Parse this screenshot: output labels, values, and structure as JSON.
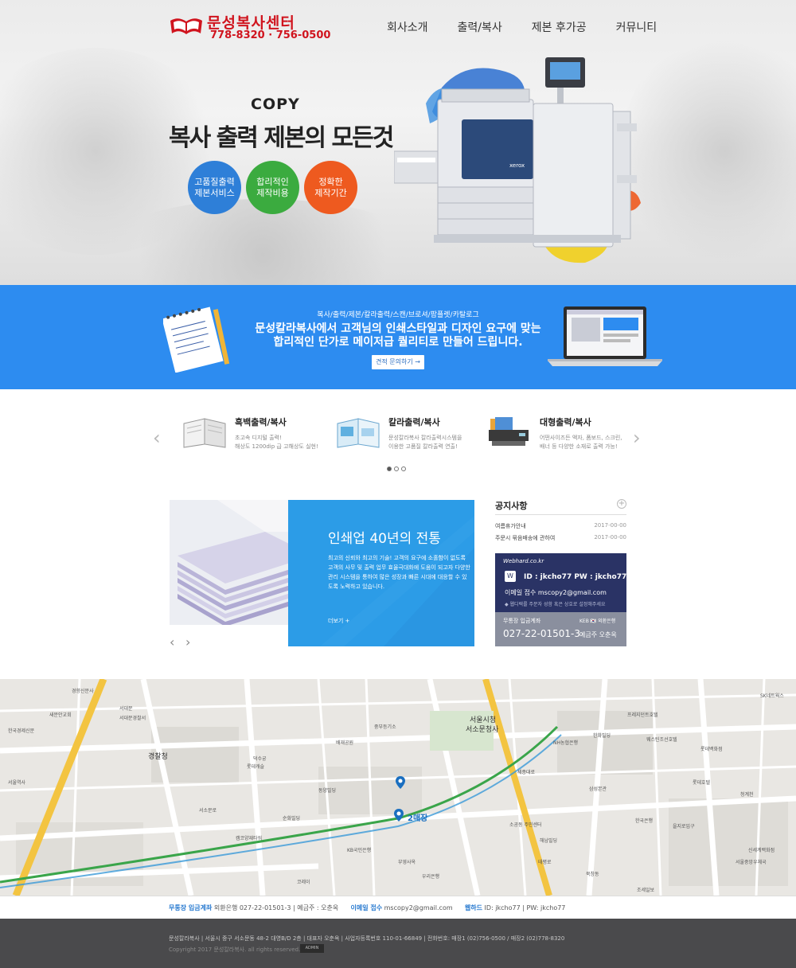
{
  "header": {
    "logo_name": "문성복사센터",
    "logo_phone": "778-8320 · 756-0500",
    "nav": [
      "회사소개",
      "출력/복사",
      "제본 후가공",
      "커뮤니티"
    ]
  },
  "hero": {
    "eyebrow": "COPY",
    "title": "복사 출력 제본의 모든것",
    "badges": [
      {
        "line1": "고품질출력",
        "line2": "제본서비스",
        "color": "#2e7fd8"
      },
      {
        "line1": "합리적인",
        "line2": "제작비용",
        "color": "#3bab3f"
      },
      {
        "line1": "정확한",
        "line2": "제작기간",
        "color": "#ee5a1f"
      }
    ],
    "printer_brand": "xerox"
  },
  "banner": {
    "sub": "복사/출력/제본/칼라출력/스캔/브로셔/팜플렛/카탈로그",
    "line1": "문성칼라복사에서 고객님의 인쇄스타일과 디자인 요구에 맞는",
    "line2": "합리적인 단가로 메이저급 퀄리티로 만들어 드립니다.",
    "button": "견적 문의하기 →"
  },
  "services": [
    {
      "title": "흑백출력/복사",
      "d1": "초고속 디지털 출력!",
      "d2": "해상도 1200dip 급 고해상도 실현!"
    },
    {
      "title": "칼라출력/복사",
      "d1": "문성칼라복사 칼라출력시스템을",
      "d2": "이용한 고품질 칼라출력 연출!"
    },
    {
      "title": "대형출력/복사",
      "d1": "어떤사이즈든 액자, 폼보드, 스크린,",
      "d2": "배너 등 다양한 소재로 출력 가능!"
    }
  ],
  "feature": {
    "title": "인쇄업 40년의 전통",
    "body": "최고의 신뢰와 최고의 기술! 고객의 요구에 소홀함이 없도록 고객의 사무 및 출력 업무 효율극대화에 도움이 되고자 다양한 관리 시스템을 통하여 많은 성장과 빠른 시대에 대응할 수 있도록 노력하고 있습니다.",
    "more": "더보기 +"
  },
  "notice": {
    "title": "공지사항",
    "items": [
      {
        "title": "여름휴가안내",
        "date": "2017-00-00"
      },
      {
        "title": "주문시 묶음배송에 관하여",
        "date": "2017-00-00"
      }
    ]
  },
  "webhard": {
    "brand": "Webhard.co.kr",
    "icon": "W",
    "idpw": "ID : jkcho77    PW : jkcho77",
    "mail": "이메일 접수     mscopy2@gmail.com",
    "note": "◆ 웹디렉를 주문자 성함 혹은 상호로 설정해주세요",
    "bank_label": "무통장 입금계좌",
    "account": "027-22-01501-3",
    "bank_name": "KEB 🇰🇷 외환은행",
    "holder": "예금주 오춘옥"
  },
  "map": {
    "store2": "2매장",
    "labels": [
      "서울시청",
      "서소문청사",
      "경찰청",
      "중부등기소",
      "한화빌딩",
      "롯데캐슬",
      "덕수궁",
      "동양빌딩",
      "순화빌딩",
      "한국은행",
      "삼성본관",
      "북창동",
      "웨스틴조선호텔",
      "롯데백화점",
      "서울역사",
      "서대문",
      "경향신문사",
      "서대문경찰서",
      "KB국민은행",
      "NH농협은행",
      "새문안교회",
      "배재공원",
      "캠코양재타워",
      "프레지던트호텔",
      "소공동 주민센터",
      "해남빌딩",
      "조세일보",
      "한국경제신문",
      "롯데호텔",
      "신세계백화점",
      "우리은행",
      "부영사옥",
      "코레이",
      "서울중앙우체국",
      "SK네트웍스",
      "을지로입구",
      "청계천",
      "세종대로",
      "서소문로",
      "태평로"
    ]
  },
  "infobar": {
    "bank_key": "무통장 입금계좌",
    "bank_val": "외환은행 027-22-01501-3  |  예금주 : 오춘옥",
    "mail_key": "이메일 접수",
    "mail_val": "mscopy2@gmail.com",
    "web_key": "웹하드",
    "web_val": "ID: jkcho77  |  PW: jkcho77"
  },
  "footer": {
    "line1": "문성칼라복사  |  서울시 중구 서소문동 48-2 대영B/D 2층  |  대표자 오춘옥  |  사업자등록번호 110-01-66849  |  전화번호: 매장1 (02)756-0500 / 매장2 (02)778-8320",
    "line2": "Copyright 2017 문성칼라복사. all rights reserved.",
    "admin": "ADMIN"
  }
}
